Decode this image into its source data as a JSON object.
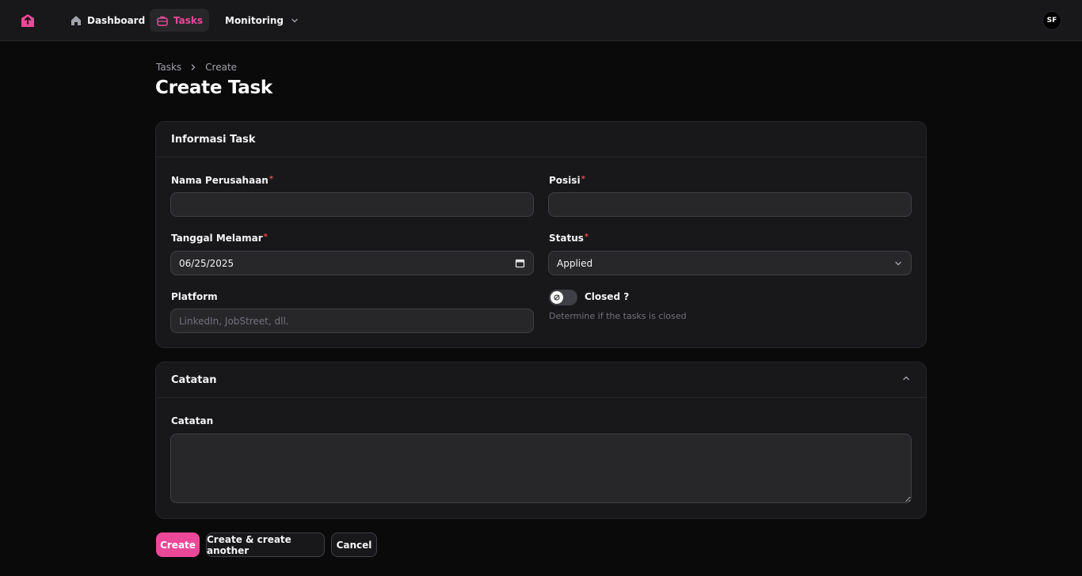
{
  "nav": {
    "items": [
      {
        "label": "Dashboard",
        "icon": "home-icon"
      },
      {
        "label": "Tasks",
        "icon": "briefcase-icon",
        "active": true
      },
      {
        "label": "Monitoring",
        "icon": "chevron-down-icon"
      }
    ],
    "avatar_initials": "SF"
  },
  "breadcrumb": [
    "Tasks",
    "Create"
  ],
  "page_title": "Create Task",
  "section_info": {
    "title": "Informasi Task",
    "nama_perusahaan": {
      "label": "Nama Perusahaan",
      "value": ""
    },
    "posisi": {
      "label": "Posisi",
      "value": ""
    },
    "tanggal_melamar": {
      "label": "Tanggal Melamar",
      "value": "06/25/2025"
    },
    "status": {
      "label": "Status",
      "value": "Applied"
    },
    "platform": {
      "label": "Platform",
      "placeholder": "LinkedIn, JobStreet, dll."
    },
    "closed": {
      "label": "Closed ?",
      "helper": "Determine if the tasks is closed",
      "checked": false
    },
    "required_mark": "*"
  },
  "section_notes": {
    "title": "Catatan",
    "field_label": "Catatan",
    "value": ""
  },
  "actions": {
    "create": "Create",
    "create_another": "Create & create another",
    "cancel": "Cancel"
  },
  "colors": {
    "accent": "#ec4899",
    "background": "#0a0a0b",
    "surface": "#18181b",
    "required": "#ef4444"
  }
}
